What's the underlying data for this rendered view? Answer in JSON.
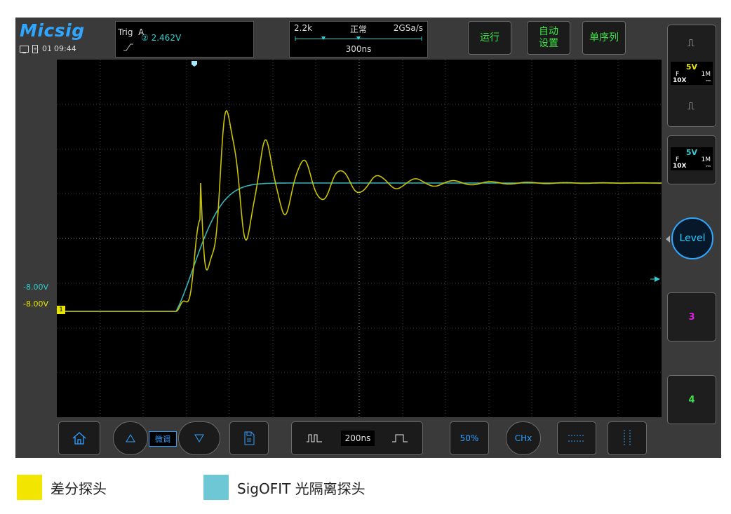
{
  "brand": "Micsig",
  "status": {
    "channel": "01",
    "time": "09:44"
  },
  "trigger": {
    "label": "Trig",
    "mode": "A",
    "source": "②",
    "value": "2.462V"
  },
  "timebase": {
    "memory": "2.2k",
    "mode": "正常",
    "rate": "2GSa/s",
    "scale": "300ns"
  },
  "top_buttons": {
    "run": "运行",
    "auto_line1": "自动",
    "auto_line2": "设置",
    "single": "单序列"
  },
  "axis_labels": {
    "ch2_offset": "-8.00V",
    "ch1_offset": "-8.00V",
    "ch1_marker": "1"
  },
  "channels": [
    {
      "id": "1",
      "volts": "5V",
      "coupling": "F",
      "impedance": "1M",
      "probe": "10X",
      "color": "#ffff00"
    },
    {
      "id": "2",
      "volts": "5V",
      "coupling": "F",
      "impedance": "1M",
      "probe": "10X",
      "color": "#2fcfcf"
    }
  ],
  "side": {
    "level": "Level",
    "ch3": "3",
    "ch4": "4"
  },
  "bottom": {
    "fine": "微调",
    "zoom_time": "200ns",
    "percent": "50%",
    "chx": "CHx"
  },
  "legend": [
    {
      "label": "差分探头",
      "color": "#f2e600"
    },
    {
      "label": "SigOFIT 光隔离探头",
      "color": "#6ec7d4"
    }
  ],
  "colors": {
    "ch1": "#c9c200",
    "ch2": "#35b6b8",
    "accent": "#2fa6ff",
    "run": "#3ee34a"
  }
}
